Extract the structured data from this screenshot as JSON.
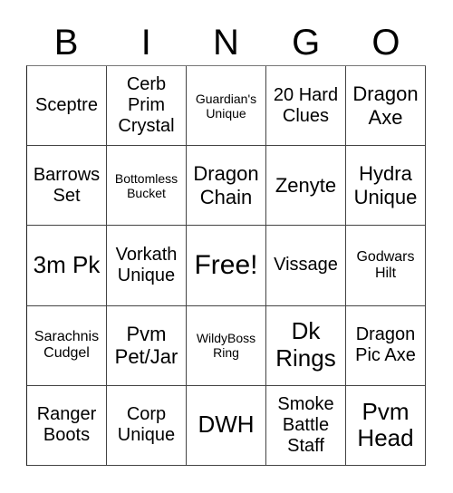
{
  "header": {
    "letters": [
      "B",
      "I",
      "N",
      "G",
      "O"
    ]
  },
  "cells": [
    [
      "Sceptre",
      "Cerb Prim Crystal",
      "Guardian's Unique",
      "20 Hard Clues",
      "Dragon Axe"
    ],
    [
      "Barrows Set",
      "Bottomless Bucket",
      "Dragon Chain",
      "Zenyte",
      "Hydra Unique"
    ],
    [
      "3m Pk",
      "Vorkath Unique",
      "Free!",
      "Vissage",
      "Godwars Hilt"
    ],
    [
      "Sarachnis Cudgel",
      "Pvm Pet/Jar",
      "WildyBoss Ring",
      "Dk Rings",
      "Dragon Pic Axe"
    ],
    [
      "Ranger Boots",
      "Corp Unique",
      "DWH",
      "Smoke Battle Staff",
      "Pvm Head"
    ]
  ],
  "free_space": {
    "row": 2,
    "col": 2,
    "label": "Free!"
  }
}
